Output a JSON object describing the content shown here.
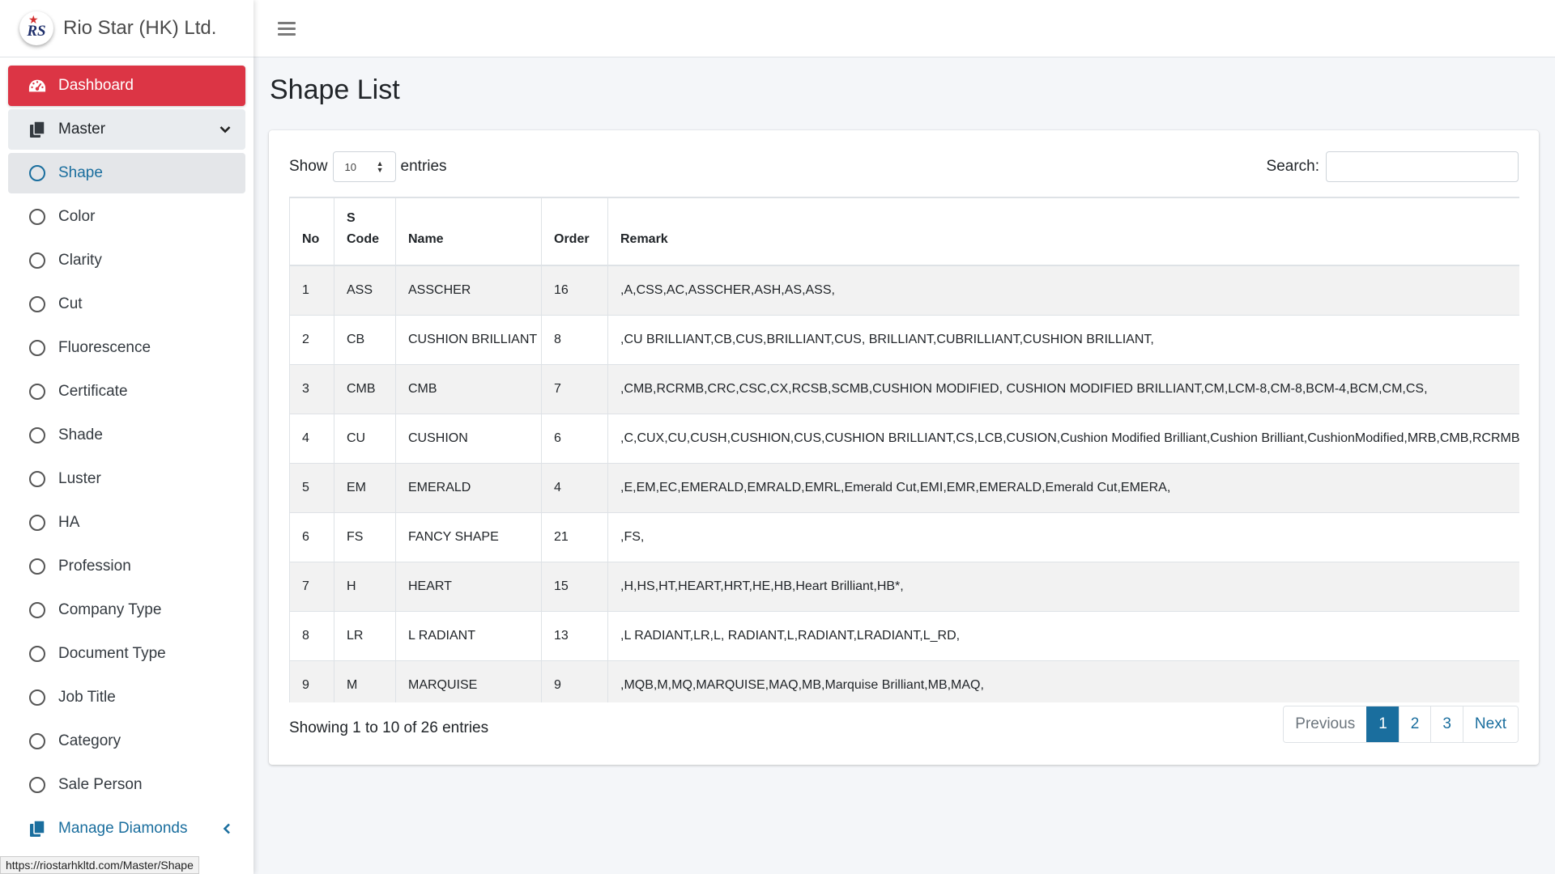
{
  "brand": {
    "name": "Rio Star (HK) Ltd.",
    "logo_text": "RS"
  },
  "sidebar": {
    "items": [
      {
        "label": "Dashboard",
        "icon": "dashboard-gauge-icon"
      },
      {
        "label": "Master",
        "icon": "copy-files-icon"
      },
      {
        "label": "Shape",
        "icon": "circle-icon"
      },
      {
        "label": "Color",
        "icon": "circle-icon"
      },
      {
        "label": "Clarity",
        "icon": "circle-icon"
      },
      {
        "label": "Cut",
        "icon": "circle-icon"
      },
      {
        "label": "Fluorescence",
        "icon": "circle-icon"
      },
      {
        "label": "Certificate",
        "icon": "circle-icon"
      },
      {
        "label": "Shade",
        "icon": "circle-icon"
      },
      {
        "label": "Luster",
        "icon": "circle-icon"
      },
      {
        "label": "HA",
        "icon": "circle-icon"
      },
      {
        "label": "Profession",
        "icon": "circle-icon"
      },
      {
        "label": "Company Type",
        "icon": "circle-icon"
      },
      {
        "label": "Document Type",
        "icon": "circle-icon"
      },
      {
        "label": "Job Title",
        "icon": "circle-icon"
      },
      {
        "label": "Category",
        "icon": "circle-icon"
      },
      {
        "label": "Sale Person",
        "icon": "circle-icon"
      },
      {
        "label": "Manage Diamonds",
        "icon": "copy-files-icon"
      }
    ]
  },
  "status_url": "https://riostarhkltd.com/Master/Shape",
  "page": {
    "title": "Shape List"
  },
  "controls": {
    "show_label": "Show",
    "entries_value": "10",
    "entries_label": "entries",
    "search_label": "Search:",
    "search_value": ""
  },
  "table": {
    "headers": {
      "no": "No",
      "code_line1": "S",
      "code_line2": "Code",
      "name": "Name",
      "order": "Order",
      "remark": "Remark"
    },
    "rows": [
      {
        "no": "1",
        "code": "ASS",
        "name": "ASSCHER",
        "order": "16",
        "remark": ",A,CSS,AC,ASSCHER,ASH,AS,ASS,"
      },
      {
        "no": "2",
        "code": "CB",
        "name": "CUSHION BRILLIANT",
        "order": "8",
        "remark": ",CU BRILLIANT,CB,CUS,BRILLIANT,CUS, BRILLIANT,CUBRILLIANT,CUSHION BRILLIANT,"
      },
      {
        "no": "3",
        "code": "CMB",
        "name": "CMB",
        "order": "7",
        "remark": ",CMB,RCRMB,CRC,CSC,CX,RCSB,SCMB,CUSHION MODIFIED, CUSHION MODIFIED BRILLIANT,CM,LCM-8,CM-8,BCM-4,BCM,CM,CS,"
      },
      {
        "no": "4",
        "code": "CU",
        "name": "CUSHION",
        "order": "6",
        "remark": ",C,CUX,CU,CUSH,CUSHION,CUS,CUSHION BRILLIANT,CS,LCB,CUSION,Cushion Modified Brilliant,Cushion Brilliant,CushionModified,MRB,CMB,RCRMB,CRC"
      },
      {
        "no": "5",
        "code": "EM",
        "name": "EMERALD",
        "order": "4",
        "remark": ",E,EM,EC,EMERALD,EMRALD,EMRL,Emerald Cut,EMI,EMR,EMERALD,Emerald Cut,EMERA,"
      },
      {
        "no": "6",
        "code": "FS",
        "name": "FANCY SHAPE",
        "order": "21",
        "remark": ",FS,"
      },
      {
        "no": "7",
        "code": "H",
        "name": "HEART",
        "order": "15",
        "remark": ",H,HS,HT,HEART,HRT,HE,HB,Heart Brilliant,HB*,"
      },
      {
        "no": "8",
        "code": "LR",
        "name": "L RADIANT",
        "order": "13",
        "remark": ",L RADIANT,LR,L, RADIANT,L,RADIANT,LRADIANT,L_RD,"
      },
      {
        "no": "9",
        "code": "M",
        "name": "MARQUISE",
        "order": "9",
        "remark": ",MQB,M,MQ,MARQUISE,MAQ,MB,Marquise Brilliant,MB,MAQ,"
      }
    ]
  },
  "footer": {
    "info": "Showing 1 to 10 of 26 entries",
    "pages": [
      "Previous",
      "1",
      "2",
      "3",
      "Next"
    ]
  },
  "colors": {
    "accent_red": "#dc3545",
    "link_blue": "#1a6e9e"
  }
}
